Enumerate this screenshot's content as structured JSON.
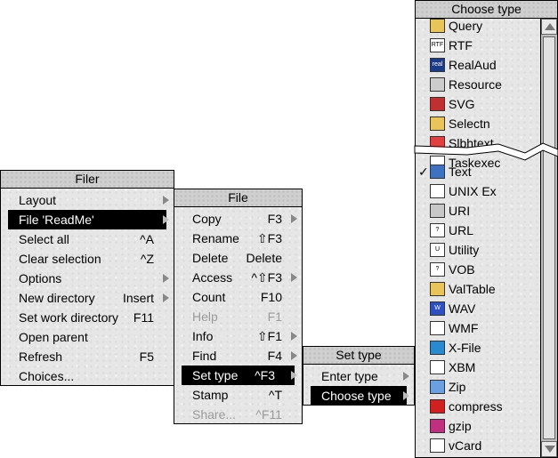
{
  "filer": {
    "title": "Filer",
    "items": [
      {
        "label": "Layout",
        "shortcut": "",
        "submenu": true
      },
      {
        "label": "File 'ReadMe'",
        "shortcut": "",
        "submenu": true,
        "selected": true
      },
      {
        "label": "Select all",
        "shortcut": "^A"
      },
      {
        "label": "Clear selection",
        "shortcut": "^Z"
      },
      {
        "label": "Options",
        "shortcut": "",
        "submenu": true
      },
      {
        "label": "New directory",
        "shortcut": "Insert",
        "submenu": true
      },
      {
        "label": "Set work directory",
        "shortcut": "F11"
      },
      {
        "label": "Open parent",
        "shortcut": ""
      },
      {
        "label": "Refresh",
        "shortcut": "F5"
      },
      {
        "label": "Choices...",
        "shortcut": ""
      }
    ]
  },
  "file_menu": {
    "title": "File",
    "items": [
      {
        "label": "Copy",
        "shortcut": "F3",
        "submenu": true
      },
      {
        "label": "Rename",
        "shortcut": "⇧F3"
      },
      {
        "label": "Delete",
        "shortcut": "Delete"
      },
      {
        "label": "Access",
        "shortcut": "^⇧F3",
        "submenu": true
      },
      {
        "label": "Count",
        "shortcut": "F10"
      },
      {
        "label": "Help",
        "shortcut": "F1",
        "disabled": true
      },
      {
        "label": "Info",
        "shortcut": "⇧F1",
        "submenu": true
      },
      {
        "label": "Find",
        "shortcut": "F4",
        "submenu": true
      },
      {
        "label": "Set type",
        "shortcut": "^F3",
        "submenu": true,
        "selected": true
      },
      {
        "label": "Stamp",
        "shortcut": "^T"
      },
      {
        "label": "Share...",
        "shortcut": "^F11",
        "disabled": true
      }
    ]
  },
  "set_type": {
    "title": "Set type",
    "items": [
      {
        "label": "Enter type",
        "submenu": true
      },
      {
        "label": "Choose type",
        "submenu": true,
        "selected": true
      }
    ]
  },
  "choose_type": {
    "title": "Choose type",
    "types_top": [
      {
        "label": "Query",
        "icon": "query-icon",
        "color": "#e8c45a"
      },
      {
        "label": "RTF",
        "icon": "rtf-icon",
        "color": "#ffffff",
        "text": "RTF"
      },
      {
        "label": "RealAud",
        "icon": "realaudio-icon",
        "color": "#1a3a8a",
        "text": "real"
      },
      {
        "label": "Resource",
        "icon": "resource-icon",
        "color": "#cccccc"
      },
      {
        "label": "SVG",
        "icon": "svg-icon",
        "color": "#c03030"
      },
      {
        "label": "Selectn",
        "icon": "selection-icon",
        "color": "#e8c45a"
      },
      {
        "label": "Slbhtext",
        "icon": "slbhtext-icon",
        "color": "#e04040"
      },
      {
        "label": "Taskexec",
        "icon": "taskexec-icon",
        "color": "#ffffff"
      }
    ],
    "types_bottom": [
      {
        "label": "Text",
        "icon": "text-file-icon",
        "color": "#4070c0",
        "checked": true
      },
      {
        "label": "UNIX Ex",
        "icon": "unix-exec-icon",
        "color": "#ffffff"
      },
      {
        "label": "URI",
        "icon": "uri-icon",
        "color": "#c8c8c8"
      },
      {
        "label": "URL",
        "icon": "url-icon",
        "color": "#ffffff",
        "text": "?"
      },
      {
        "label": "Utility",
        "icon": "utility-icon",
        "color": "#ffffff",
        "text": "U"
      },
      {
        "label": "VOB",
        "icon": "vob-icon",
        "color": "#ffffff",
        "text": "?"
      },
      {
        "label": "ValTable",
        "icon": "valtable-icon",
        "color": "#e8c45a"
      },
      {
        "label": "WAV",
        "icon": "wav-icon",
        "color": "#3050c0",
        "text": "W"
      },
      {
        "label": "WMF",
        "icon": "wmf-icon",
        "color": "#ffffff"
      },
      {
        "label": "X-File",
        "icon": "x-file-icon",
        "color": "#2a8ad0"
      },
      {
        "label": "XBM",
        "icon": "xbm-icon",
        "color": "#ffffff"
      },
      {
        "label": "Zip",
        "icon": "zip-icon",
        "color": "#6aa0e0"
      },
      {
        "label": "compress",
        "icon": "compress-icon",
        "color": "#d02020"
      },
      {
        "label": "gzip",
        "icon": "gzip-icon",
        "color": "#c03080"
      },
      {
        "label": "vCard",
        "icon": "vcard-icon",
        "color": "#ffffff"
      }
    ],
    "check_glyph": "✓"
  }
}
